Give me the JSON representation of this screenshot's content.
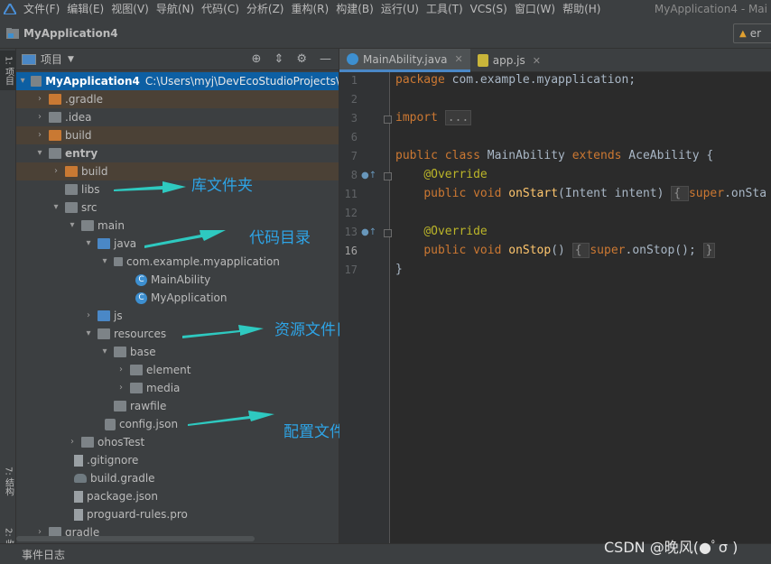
{
  "menubar": {
    "items": [
      "文件(F)",
      "编辑(E)",
      "视图(V)",
      "导航(N)",
      "代码(C)",
      "分析(Z)",
      "重构(R)",
      "构建(B)",
      "运行(U)",
      "工具(T)",
      "VCS(S)",
      "窗口(W)",
      "帮助(H)"
    ],
    "title": "MyApplication4 - Mai"
  },
  "navbar": {
    "project": "MyApplication4",
    "run_config": "er"
  },
  "left_tabs": {
    "project": "1: 项目",
    "structure": "7: 结构",
    "favorites": "2: 收藏"
  },
  "project_panel": {
    "header_label": "项目",
    "tree": [
      {
        "label": "MyApplication4",
        "path": "C:\\Users\\myj\\DevEcoStudioProjects\\"
      },
      {
        "label": ".gradle"
      },
      {
        "label": ".idea"
      },
      {
        "label": "build"
      },
      {
        "label": "entry"
      },
      {
        "label": "build"
      },
      {
        "label": "libs"
      },
      {
        "label": "src"
      },
      {
        "label": "main"
      },
      {
        "label": "java"
      },
      {
        "label": "com.example.myapplication"
      },
      {
        "label": "MainAbility"
      },
      {
        "label": "MyApplication"
      },
      {
        "label": "js"
      },
      {
        "label": "resources"
      },
      {
        "label": "base"
      },
      {
        "label": "element"
      },
      {
        "label": "media"
      },
      {
        "label": "rawfile"
      },
      {
        "label": "config.json"
      },
      {
        "label": "ohosTest"
      },
      {
        "label": ".gitignore"
      },
      {
        "label": "build.gradle"
      },
      {
        "label": "package.json"
      },
      {
        "label": "proguard-rules.pro"
      },
      {
        "label": "gradle"
      }
    ]
  },
  "annotations": {
    "libs": "库文件夹",
    "code": "代码目录",
    "resources": "资源文件目录",
    "config": "配置文件"
  },
  "editor": {
    "tabs": [
      {
        "label": "MainAbility.java",
        "icon": "class-icon"
      },
      {
        "label": "app.js",
        "icon": "js-file-icon"
      }
    ],
    "line_numbers": [
      "1",
      "2",
      "3",
      "6",
      "7",
      "8",
      "11",
      "12",
      "13",
      "16",
      "17"
    ],
    "code": {
      "l1_kw": "package",
      "l1_rest": " com.example.myapplication;",
      "l3_kw": "import",
      "l3_fold": "...",
      "l6_kw1": "public",
      "l6_kw2": "class",
      "l6_name": " MainAbility ",
      "l6_kw3": "extends",
      "l6_rest": " AceAbility {",
      "l7_an": "@Override",
      "l8_kw1": "public",
      "l8_kw2": "void",
      "l8_fn": "onStart",
      "l8_rest": "(Intent intent)",
      "l8_fold": "{ ",
      "l8_super": "super",
      "l8_tail": ".onSta",
      "l12_an": "@Override",
      "l13_kw1": "public",
      "l13_kw2": "void",
      "l13_fn": "onStop",
      "l13_rest": "()",
      "l13_fold_open": "{ ",
      "l13_super": "super",
      "l13_tail": ".onStop(); ",
      "l13_fold_close": "}",
      "l16": "}"
    }
  },
  "status": {
    "event_log": "事件日志"
  },
  "watermark": "CSDN @晚风(●ﾟσ )"
}
